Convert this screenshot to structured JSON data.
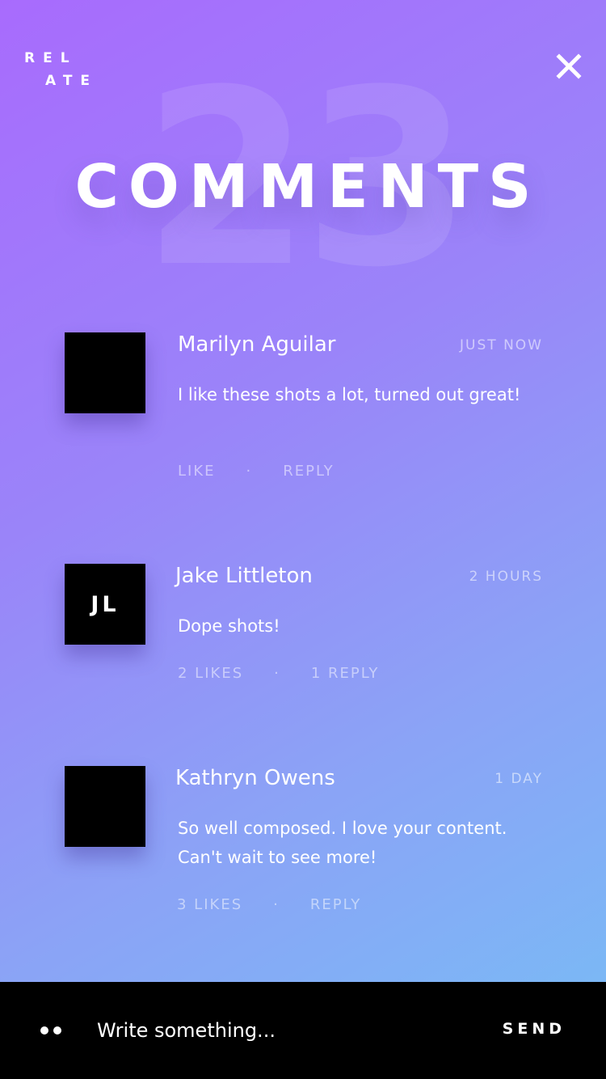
{
  "brand": {
    "line1": "REL",
    "line2": "ATE"
  },
  "header": {
    "count": "23",
    "title": "COMMENTS",
    "close_icon": "close-icon"
  },
  "comments": [
    {
      "author": "Marilyn Aguilar",
      "time": "JUST NOW",
      "text": "I like these shots a lot, turned out great!",
      "avatar_initials": "",
      "like_label": "LIKE",
      "reply_label": "REPLY",
      "separator": "·"
    },
    {
      "author": "Jake Littleton",
      "time": "2 HOURS",
      "text": "Dope shots!",
      "avatar_initials": "JL",
      "like_label": "2 LIKES",
      "reply_label": "1 REPLY",
      "separator": "·"
    },
    {
      "author": "Kathryn Owens",
      "time": "1 DAY",
      "text": "So well composed. I love your content. Can't wait to see more!",
      "avatar_initials": "",
      "like_label": "3 LIKES",
      "reply_label": "REPLY",
      "separator": "·"
    }
  ],
  "composer": {
    "menu_icon": "more-dots-icon",
    "placeholder": "Write something...",
    "send_label": "SEND"
  },
  "colors": {
    "gradient_start": "#a86bfd",
    "gradient_end": "#77bdf5",
    "avatar_bg": "#000000",
    "composer_bg": "#000000"
  }
}
